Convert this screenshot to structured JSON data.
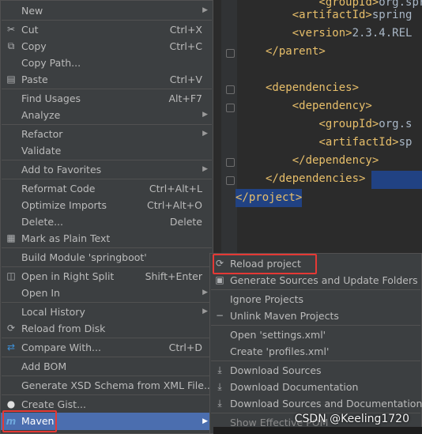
{
  "editor": {
    "lines": [
      {
        "tag": "<groupId>",
        "text": "org.sprin",
        "indent": "        "
      },
      {
        "tag": "<artifactId>",
        "text": "spring",
        "indent": "    "
      },
      {
        "tag": "<version>",
        "text": "2.3.4.REL",
        "indent": "    "
      },
      {
        "tag": "</parent>",
        "text": "",
        "indent": ""
      },
      {
        "tag": "",
        "text": "",
        "indent": ""
      },
      {
        "tag": "<dependencies>",
        "text": "",
        "indent": ""
      },
      {
        "tag": "<dependency>",
        "text": "",
        "indent": "    "
      },
      {
        "tag": "<groupId>",
        "text": "org.s",
        "indent": "        "
      },
      {
        "tag": "<artifactId>",
        "text": "sp",
        "indent": "        "
      },
      {
        "tag": "</dependency>",
        "text": "",
        "indent": "    "
      },
      {
        "tag": "</dependencies>",
        "text": "",
        "indent": ""
      },
      {
        "tag": "</project>",
        "text": "",
        "indent": ""
      }
    ]
  },
  "context_menu": {
    "items": [
      {
        "icon": "",
        "label": "New",
        "shortcut": "",
        "arrow": true
      },
      {
        "icon": "✂",
        "label": "Cut",
        "shortcut": "Ctrl+X",
        "arrow": false
      },
      {
        "icon": "⧉",
        "label": "Copy",
        "shortcut": "Ctrl+C",
        "arrow": false
      },
      {
        "icon": "",
        "label": "Copy Path...",
        "shortcut": "",
        "arrow": false
      },
      {
        "icon": "▤",
        "label": "Paste",
        "shortcut": "Ctrl+V",
        "arrow": false
      },
      {
        "icon": "",
        "label": "Find Usages",
        "shortcut": "Alt+F7",
        "arrow": false
      },
      {
        "icon": "",
        "label": "Analyze",
        "shortcut": "",
        "arrow": true
      },
      {
        "icon": "",
        "label": "Refactor",
        "shortcut": "",
        "arrow": true
      },
      {
        "icon": "",
        "label": "Validate",
        "shortcut": "",
        "arrow": false
      },
      {
        "icon": "",
        "label": "Add to Favorites",
        "shortcut": "",
        "arrow": true
      },
      {
        "icon": "",
        "label": "Reformat Code",
        "shortcut": "Ctrl+Alt+L",
        "arrow": false
      },
      {
        "icon": "",
        "label": "Optimize Imports",
        "shortcut": "Ctrl+Alt+O",
        "arrow": false
      },
      {
        "icon": "",
        "label": "Delete...",
        "shortcut": "Delete",
        "arrow": false
      },
      {
        "icon": "▦",
        "label": "Mark as Plain Text",
        "shortcut": "",
        "arrow": false
      },
      {
        "icon": "",
        "label": "Build Module 'springboot'",
        "shortcut": "",
        "arrow": false
      },
      {
        "icon": "◫",
        "label": "Open in Right Split",
        "shortcut": "Shift+Enter",
        "arrow": false
      },
      {
        "icon": "",
        "label": "Open In",
        "shortcut": "",
        "arrow": true
      },
      {
        "icon": "",
        "label": "Local History",
        "shortcut": "",
        "arrow": true
      },
      {
        "icon": "⟳",
        "label": "Reload from Disk",
        "shortcut": "",
        "arrow": false
      },
      {
        "icon": "⇄",
        "label": "Compare With...",
        "shortcut": "Ctrl+D",
        "arrow": false
      },
      {
        "icon": "",
        "label": "Add BOM",
        "shortcut": "",
        "arrow": false
      },
      {
        "icon": "",
        "label": "Generate XSD Schema from XML File...",
        "shortcut": "",
        "arrow": false
      },
      {
        "icon": "●",
        "label": "Create Gist...",
        "shortcut": "",
        "arrow": false
      },
      {
        "icon": "m",
        "label": "Maven",
        "shortcut": "",
        "arrow": true
      }
    ]
  },
  "maven_submenu": {
    "items": [
      {
        "icon": "⟳",
        "label": "Reload project"
      },
      {
        "icon": "▣",
        "label": "Generate Sources and Update Folders"
      },
      {
        "icon": "",
        "label": "Ignore Projects"
      },
      {
        "icon": "",
        "label": "Unlink Maven Projects"
      },
      {
        "icon": "",
        "label": "Open 'settings.xml'"
      },
      {
        "icon": "",
        "label": "Create 'profiles.xml'"
      },
      {
        "icon": "⤓",
        "label": "Download Sources"
      },
      {
        "icon": "⤓",
        "label": "Download Documentation"
      },
      {
        "icon": "⤓",
        "label": "Download Sources and Documentation"
      },
      {
        "icon": "",
        "label": "Show Effective POM"
      }
    ]
  },
  "watermark": "CSDN @Keeling1720",
  "colors": {
    "selection": "#4b6eaf",
    "highlight_box": "#e53935",
    "menu_bg": "#3c3f41"
  }
}
